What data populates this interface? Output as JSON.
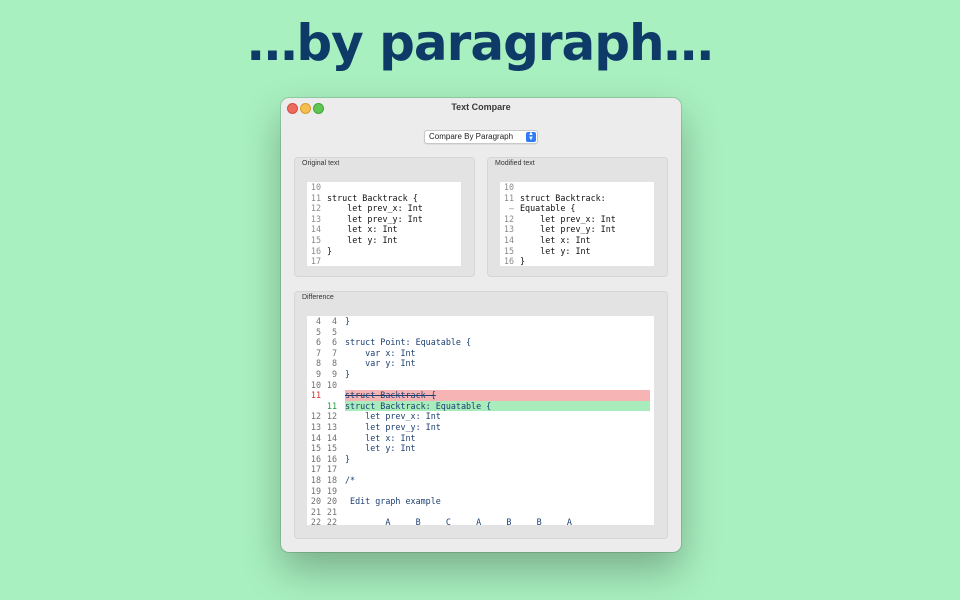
{
  "headline": "…by paragraph…",
  "window": {
    "title": "Text Compare"
  },
  "compare_mode": {
    "selected": "Compare By Paragraph"
  },
  "original": {
    "label": "Original text",
    "lines": [
      {
        "n": "10",
        "t": ""
      },
      {
        "n": "11",
        "t": "struct Backtrack {"
      },
      {
        "n": "12",
        "t": "    let prev_x: Int"
      },
      {
        "n": "13",
        "t": "    let prev_y: Int"
      },
      {
        "n": "14",
        "t": "    let x: Int"
      },
      {
        "n": "15",
        "t": "    let y: Int"
      },
      {
        "n": "16",
        "t": "}"
      },
      {
        "n": "17",
        "t": ""
      }
    ]
  },
  "modified": {
    "label": "Modified text",
    "lines": [
      {
        "n": "10",
        "t": ""
      },
      {
        "n": "11",
        "t": "struct Backtrack:"
      },
      {
        "n": "–",
        "t": "Equatable {"
      },
      {
        "n": "12",
        "t": "    let prev_x: Int"
      },
      {
        "n": "13",
        "t": "    let prev_y: Int"
      },
      {
        "n": "14",
        "t": "    let x: Int"
      },
      {
        "n": "15",
        "t": "    let y: Int"
      },
      {
        "n": "16",
        "t": "}"
      }
    ]
  },
  "difference": {
    "label": "Difference",
    "lines": [
      {
        "a": "4",
        "b": "4",
        "t": "}",
        "k": ""
      },
      {
        "a": "5",
        "b": "5",
        "t": "",
        "k": ""
      },
      {
        "a": "6",
        "b": "6",
        "t": "struct Point: Equatable {",
        "k": ""
      },
      {
        "a": "7",
        "b": "7",
        "t": "    var x: Int",
        "k": ""
      },
      {
        "a": "8",
        "b": "8",
        "t": "    var y: Int",
        "k": ""
      },
      {
        "a": "9",
        "b": "9",
        "t": "}",
        "k": ""
      },
      {
        "a": "10",
        "b": "10",
        "t": "",
        "k": ""
      },
      {
        "a": "11",
        "b": "",
        "t": "struct Backtrack {",
        "k": "del"
      },
      {
        "a": "",
        "b": "11",
        "t": "struct Backtrack: Equatable {",
        "k": "add"
      },
      {
        "a": "12",
        "b": "12",
        "t": "    let prev_x: Int",
        "k": ""
      },
      {
        "a": "13",
        "b": "13",
        "t": "    let prev_y: Int",
        "k": ""
      },
      {
        "a": "14",
        "b": "14",
        "t": "    let x: Int",
        "k": ""
      },
      {
        "a": "15",
        "b": "15",
        "t": "    let y: Int",
        "k": ""
      },
      {
        "a": "16",
        "b": "16",
        "t": "}",
        "k": ""
      },
      {
        "a": "17",
        "b": "17",
        "t": "",
        "k": ""
      },
      {
        "a": "18",
        "b": "18",
        "t": "/*",
        "k": ""
      },
      {
        "a": "19",
        "b": "19",
        "t": "",
        "k": ""
      },
      {
        "a": "20",
        "b": "20",
        "t": " Edit graph example",
        "k": ""
      },
      {
        "a": "21",
        "b": "21",
        "t": "",
        "k": ""
      },
      {
        "a": "22",
        "b": "22",
        "t": "        A     B     C     A     B     B     A",
        "k": ""
      }
    ]
  },
  "colors": {
    "background": "#a8f0bf",
    "headline": "#0d3a66",
    "deleted": "#f7b4b4",
    "added": "#a8ecbc",
    "accent": "#2f7cf6"
  }
}
